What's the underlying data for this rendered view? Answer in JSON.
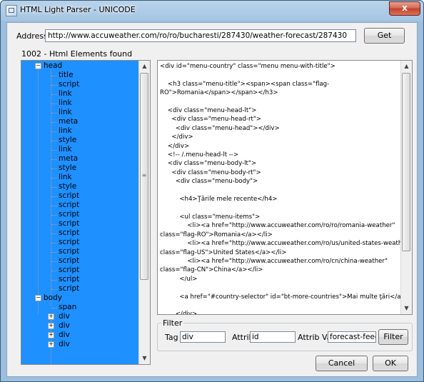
{
  "window": {
    "title": "HTML Light Parser - UNICODE",
    "close_glyph": "x"
  },
  "address": {
    "label": "Address:",
    "value": "http://www.accuweather.com/ro/ro/bucharesti/287430/weather-forecast/287430",
    "get_label": "Get"
  },
  "elements_found": "1002 - Html Elements found",
  "tree": {
    "head_label": "head",
    "head_children": [
      "title",
      "script",
      "link",
      "link",
      "link",
      "meta",
      "link",
      "style",
      "link",
      "meta",
      "style",
      "link",
      "style",
      "script",
      "script",
      "script",
      "script",
      "script",
      "script",
      "script",
      "script",
      "script",
      "script",
      "script"
    ],
    "body_label": "body",
    "body_children": [
      {
        "label": "span",
        "expandable": false
      },
      {
        "label": "div",
        "expandable": true
      },
      {
        "label": "div",
        "expandable": true
      },
      {
        "label": "div",
        "expandable": true
      },
      {
        "label": "div",
        "expandable": true
      }
    ],
    "expander_minus": "−",
    "expander_plus": "+"
  },
  "code_text": "<div id=\"menu-country\" class=\"menu menu-with-title\">\n\n    <h3 class=\"menu-title\"><span><span class=\"flag-\nRO\">Romania</span></span></h3>\n\n    <div class=\"menu-head-lt\">\n      <div class=\"menu-head-rt\">\n        <div class=\"menu-head\"></div>\n      </div>\n    </div>\n    <!-- /.menu-head-lt -->\n    <div class=\"menu-body-lt\">\n      <div class=\"menu-body-rt\">\n        <div class=\"menu-body\">\n\n          <h4>Ţările mele recente</h4>\n\n          <ul class=\"menu-items\">\n              <li><a href=\"http://www.accuweather.com/ro/ro/romania-weather\"\nclass=\"flag-RO\">Romania</a></li>\n              <li><a href=\"http://www.accuweather.com/ro/us/united-states-weather\"\nclass=\"flag-US\">United States</a></li>\n              <li><a href=\"http://www.accuweather.com/ro/cn/china-weather\"\nclass=\"flag-CN\">China</a></li>\n          </ul>\n\n          <a href=\"#country-selector\" id=\"bt-more-countries\">Mai multe ţări</a>\n\n        </div>\n      </div>\n    </div>\n    <!-- /.menu-body-lt -->",
  "filter": {
    "legend": "Filter",
    "tag_label": "Tag",
    "tag_value": "div",
    "attrib_label": "Attrib",
    "attrib_value": "id",
    "attrib_val_label": "Attrib Val",
    "attrib_val_value": "forecast-feed",
    "button_label": "Filter"
  },
  "footer": {
    "cancel_label": "Cancel",
    "ok_label": "OK"
  },
  "scroll_arrows": {
    "up": "▲",
    "down": "▼",
    "grip": "≡"
  }
}
